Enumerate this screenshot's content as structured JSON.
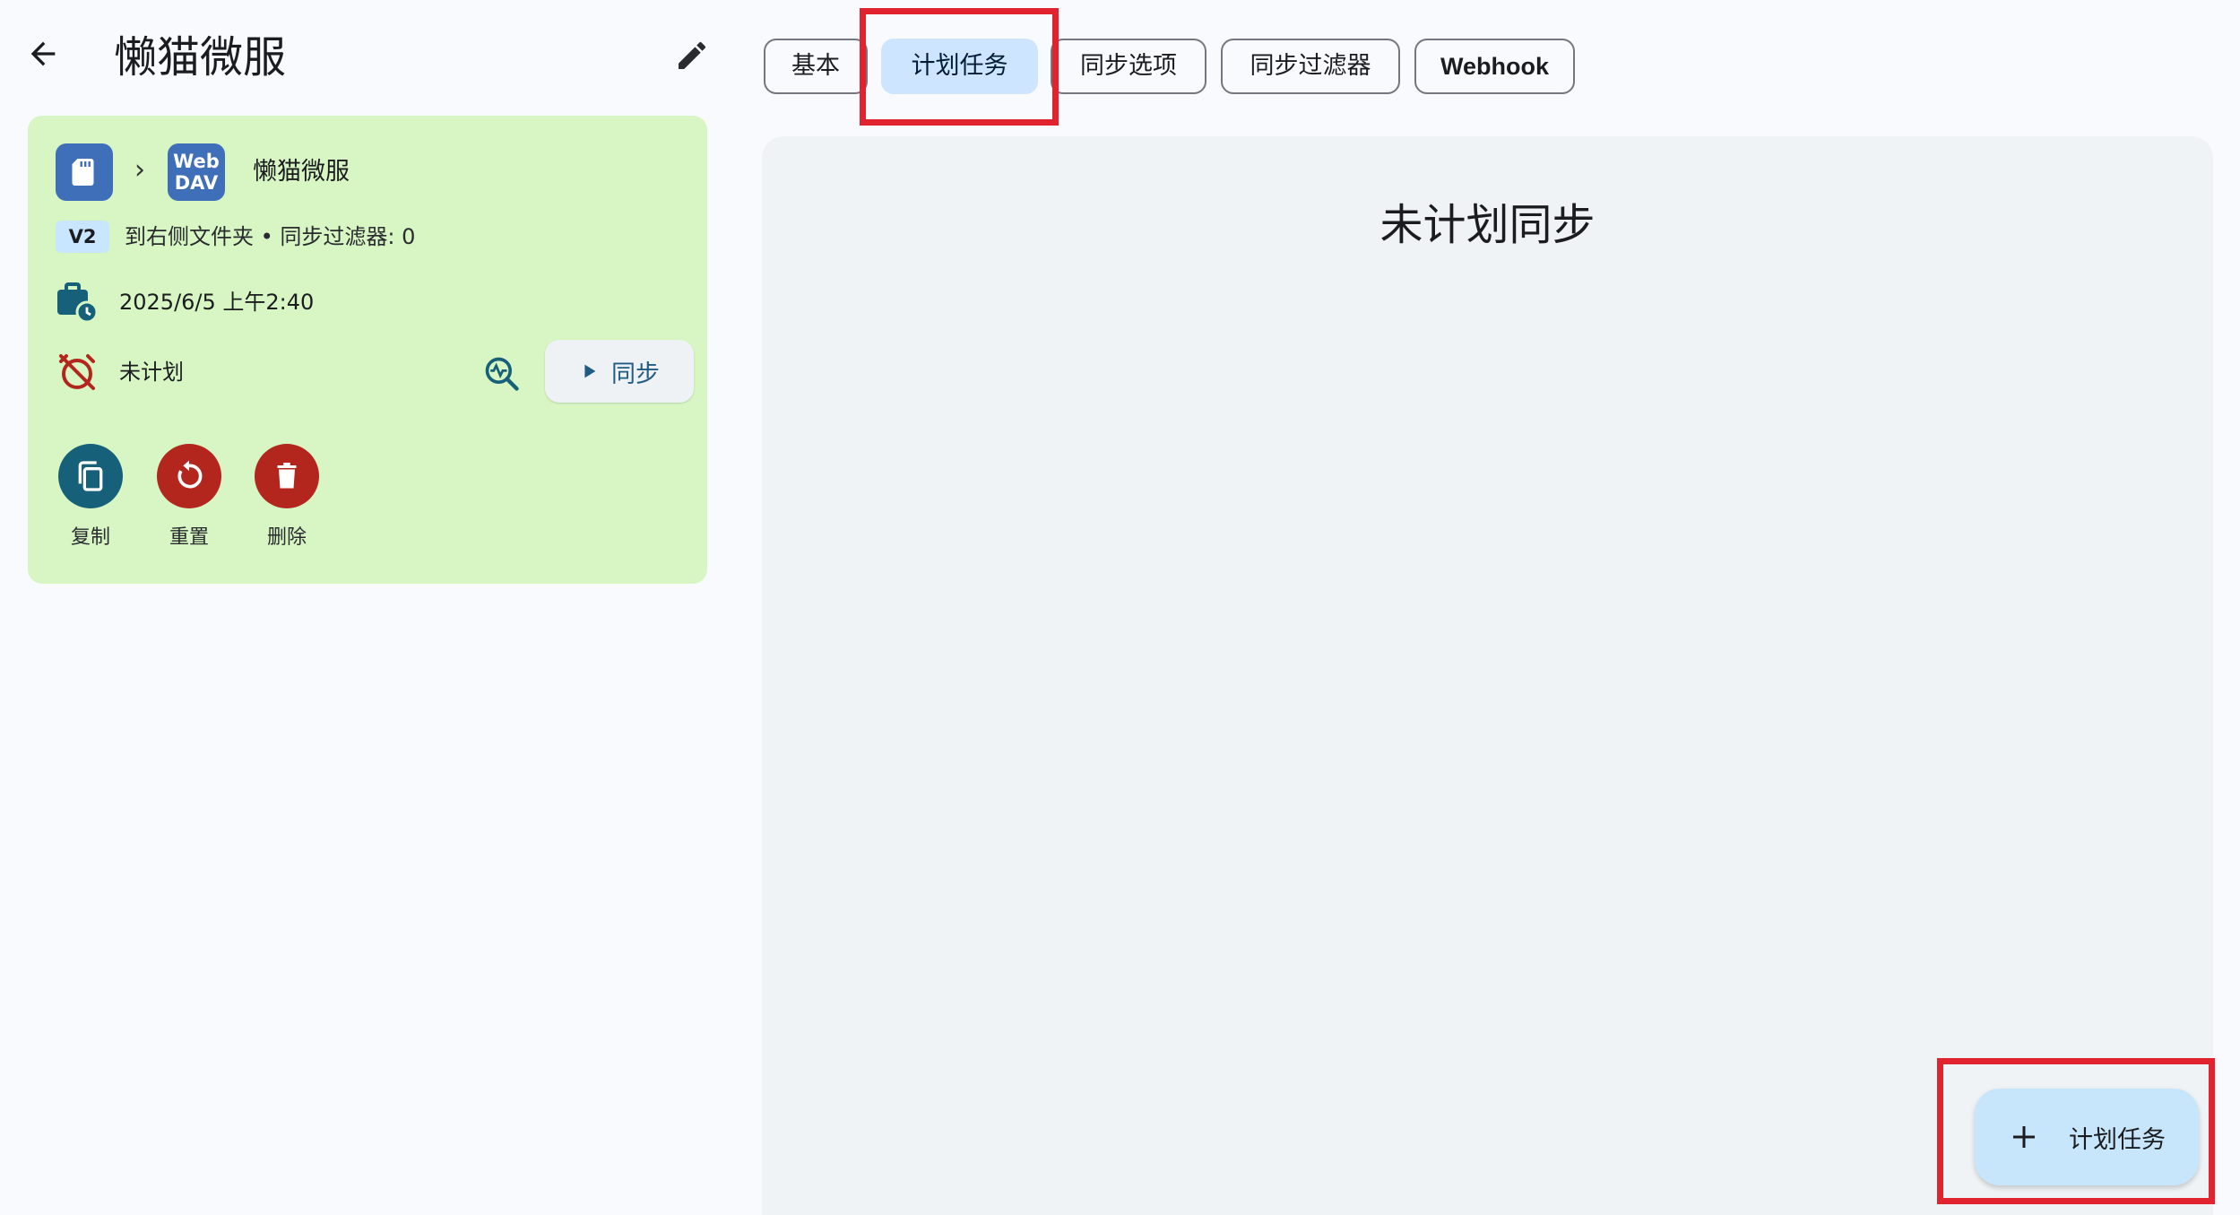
{
  "header": {
    "title": "懒猫微服"
  },
  "card": {
    "source_icon": "sd-card-icon",
    "target_icon": "webdav-icon",
    "target_line1": "Web",
    "target_line2": "DAV",
    "name": "懒猫微服",
    "version_badge": "V2",
    "info": "到右侧文件夹 • 同步过滤器: 0",
    "last_sync": "2025/6/5 上午2:40",
    "schedule_status": "未计划",
    "sync_button": "同步",
    "actions": {
      "copy": "复制",
      "reset": "重置",
      "delete": "删除"
    }
  },
  "tabs": {
    "basic": "基本",
    "schedule": "计划任务",
    "sync_options": "同步选项",
    "sync_filters": "同步过滤器",
    "webhook": "Webhook"
  },
  "content": {
    "empty_message": "未计划同步",
    "fab_label": "计划任务"
  },
  "colors": {
    "card_bg": "#d7f6c4",
    "accent_blue": "#3f6fb8",
    "danger_red": "#b3261e",
    "teal": "#16607a",
    "selected_tab": "#cde5ff",
    "highlight": "#e0232e"
  }
}
